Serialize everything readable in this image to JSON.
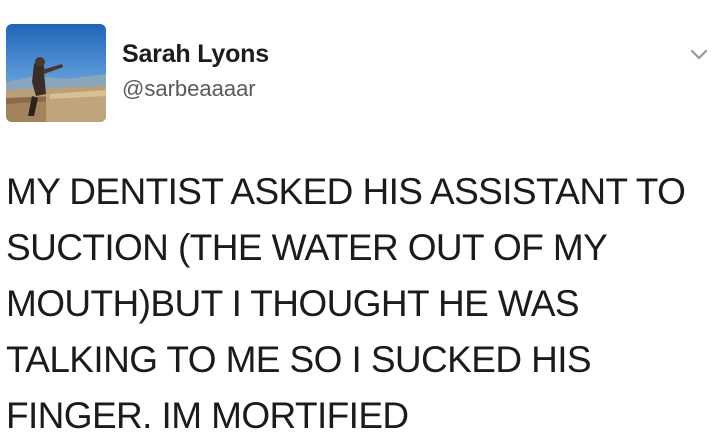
{
  "tweet": {
    "author": {
      "display_name": "Sarah Lyons",
      "handle": "@sarbeaaaar",
      "avatar_icon": "profile-photo-person-on-cliff"
    },
    "menu_icon": "chevron-down-icon",
    "text_lines": [
      "MY DENTIST ASKED HIS ASSISTANT TO",
      "SUCTION (THE WATER OUT OF MY",
      "MOUTH)BUT I THOUGHT HE WAS",
      "TALKING TO ME SO I SUCKED HIS",
      "FINGER. IM MORTIFIED"
    ]
  },
  "colors": {
    "background": "#ffffff",
    "text": "#1b1b1b",
    "handle": "#5a5a5a",
    "chevron": "#9a9a9a"
  }
}
